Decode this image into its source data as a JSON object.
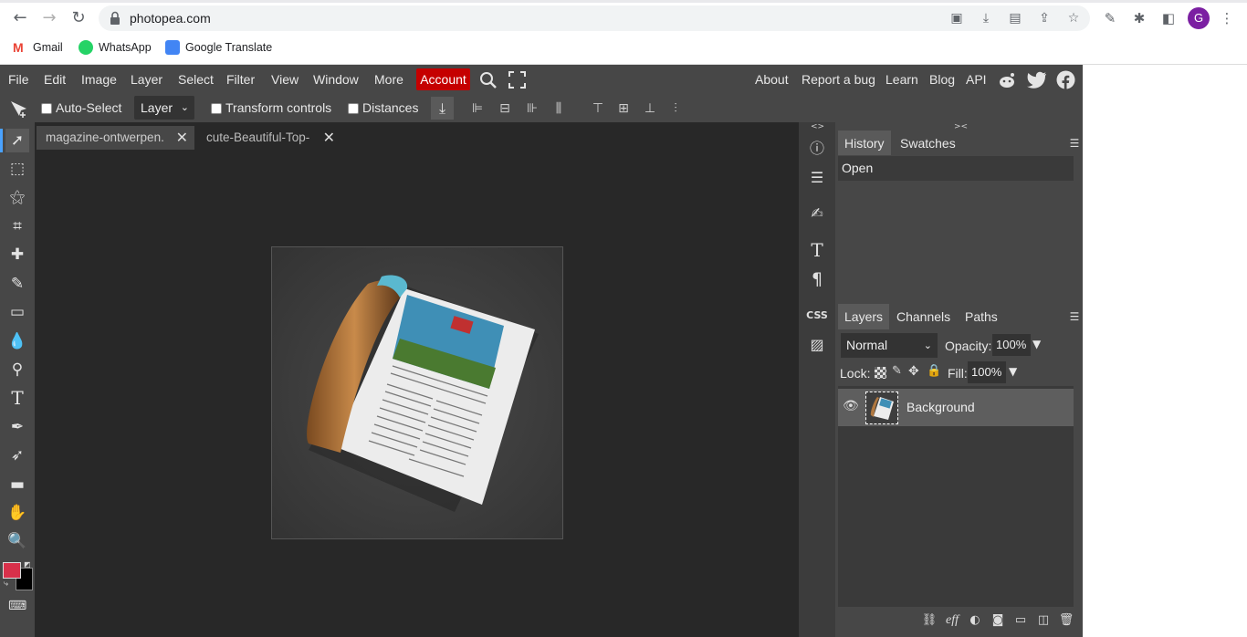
{
  "browser": {
    "url": "photopea.com",
    "bookmarks": [
      {
        "label": "Gmail",
        "color": "#ea4335"
      },
      {
        "label": "WhatsApp",
        "color": "#25d366"
      },
      {
        "label": "Google Translate",
        "color": "#4285f4"
      }
    ],
    "avatar_letter": "G"
  },
  "menubar": {
    "items": [
      "File",
      "Edit",
      "Image",
      "Layer",
      "Select",
      "Filter",
      "View",
      "Window",
      "More"
    ],
    "account": "Account",
    "right_items": [
      "About",
      "Report a bug",
      "Learn",
      "Blog",
      "API"
    ]
  },
  "options": {
    "auto_select": "Auto-Select",
    "layer_select": "Layer",
    "transform_controls": "Transform controls",
    "distances": "Distances"
  },
  "documents": {
    "tabs": [
      {
        "label": "magazine-ontwerpen.",
        "active": true
      },
      {
        "label": "cute-Beautiful-Top-",
        "active": false
      }
    ]
  },
  "panels": {
    "history_tab": "History",
    "swatches_tab": "Swatches",
    "history_items": [
      "Open"
    ],
    "layers_tab": "Layers",
    "channels_tab": "Channels",
    "paths_tab": "Paths",
    "blend_mode": "Normal",
    "opacity_label": "Opacity:",
    "opacity_value": "100%",
    "lock_label": "Lock:",
    "fill_label": "Fill:",
    "fill_value": "100%",
    "layers": [
      {
        "name": "Background",
        "visible": true
      }
    ]
  },
  "colors": {
    "foreground": "#d8304a",
    "background": "#000000",
    "account_bg": "#c50000"
  }
}
